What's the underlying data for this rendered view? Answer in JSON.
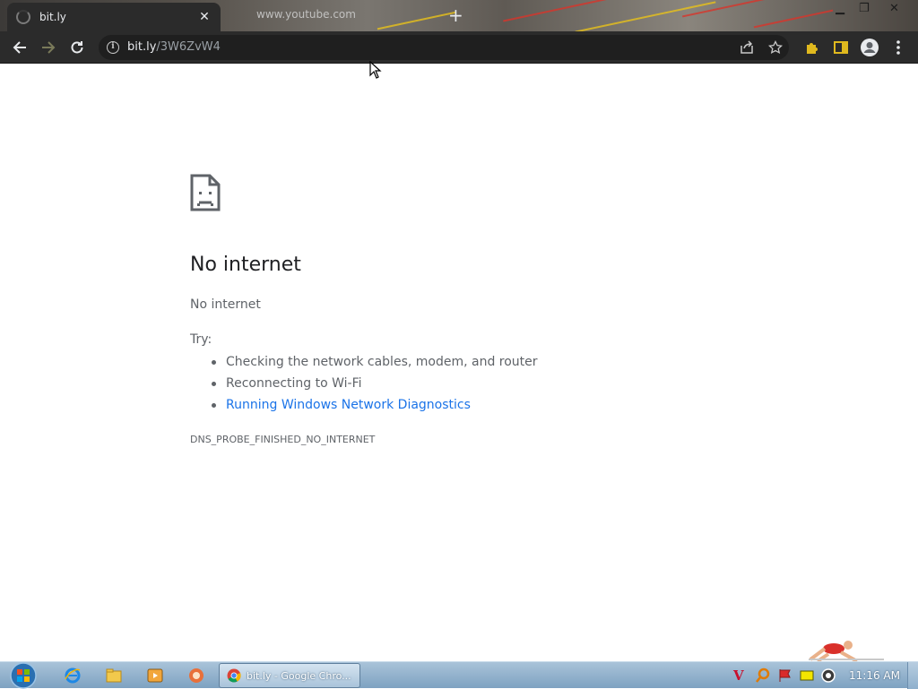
{
  "browser": {
    "active_tab_title": "bit.ly",
    "background_tab_title": "www.youtube.com",
    "url_host": "bit.ly",
    "url_path": "/3W6ZvW4"
  },
  "error_page": {
    "heading": "No internet",
    "subheading": "No internet",
    "try_label": "Try:",
    "suggestions": [
      "Checking the network cables, modem, and router",
      "Reconnecting to Wi-Fi",
      "Running Windows Network Diagnostics"
    ],
    "error_code": "DNS_PROBE_FINISHED_NO_INTERNET"
  },
  "taskbar": {
    "active_task_label": "bit.ly - Google Chro...",
    "clock": "11:16 AM"
  },
  "colors": {
    "toolbar": "#2b2b2b",
    "link": "#1a73e8",
    "text": "#5f6368",
    "heading": "#202124",
    "taskbar": "#8eadc8"
  }
}
